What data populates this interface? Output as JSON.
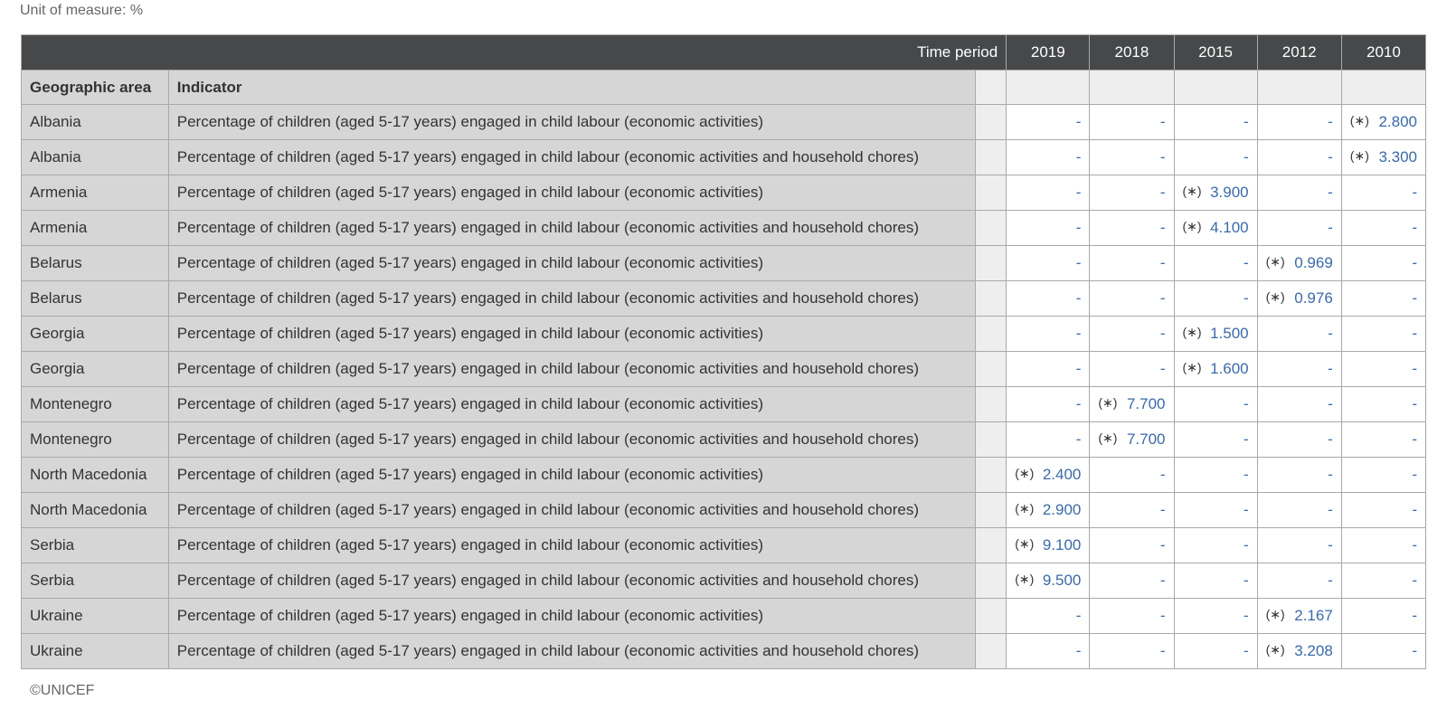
{
  "unit_label": "Unit of measure: %",
  "header": {
    "time_period": "Time period",
    "years": [
      "2019",
      "2018",
      "2015",
      "2012",
      "2010"
    ],
    "col_area": "Geographic area",
    "col_indicator": "Indicator"
  },
  "flag_symbol": "(∗)",
  "rows": [
    {
      "area": "Albania",
      "indicator": "Percentage of children (aged 5-17 years) engaged in child labour (economic activities)",
      "values": [
        "-",
        "-",
        "-",
        "-",
        "2.800"
      ],
      "flags": [
        false,
        false,
        false,
        false,
        true
      ],
      "blue": [
        false,
        false,
        false,
        false,
        true
      ]
    },
    {
      "area": "Albania",
      "indicator": "Percentage of children (aged 5-17 years) engaged in child labour (economic activities and household chores)",
      "values": [
        "-",
        "-",
        "-",
        "-",
        "3.300"
      ],
      "flags": [
        false,
        false,
        false,
        false,
        true
      ],
      "blue": [
        true,
        false,
        false,
        false,
        true
      ]
    },
    {
      "area": "Armenia",
      "indicator": "Percentage of children (aged 5-17 years) engaged in child labour (economic activities)",
      "values": [
        "-",
        "-",
        "3.900",
        "-",
        "-"
      ],
      "flags": [
        false,
        false,
        true,
        false,
        false
      ],
      "blue": [
        false,
        false,
        true,
        false,
        false
      ]
    },
    {
      "area": "Armenia",
      "indicator": "Percentage of children (aged 5-17 years) engaged in child labour (economic activities and household chores)",
      "values": [
        "-",
        "-",
        "4.100",
        "-",
        "-"
      ],
      "flags": [
        false,
        false,
        true,
        false,
        false
      ],
      "blue": [
        true,
        true,
        true,
        false,
        false
      ]
    },
    {
      "area": "Belarus",
      "indicator": "Percentage of children (aged 5-17 years) engaged in child labour (economic activities)",
      "values": [
        "-",
        "-",
        "-",
        "0.969",
        "-"
      ],
      "flags": [
        false,
        false,
        false,
        true,
        false
      ],
      "blue": [
        true,
        true,
        false,
        true,
        true
      ]
    },
    {
      "area": "Belarus",
      "indicator": "Percentage of children (aged 5-17 years) engaged in child labour (economic activities and household chores)",
      "values": [
        "-",
        "-",
        "-",
        "0.976",
        "-"
      ],
      "flags": [
        false,
        false,
        false,
        true,
        false
      ],
      "blue": [
        false,
        false,
        false,
        true,
        false
      ]
    },
    {
      "area": "Georgia",
      "indicator": "Percentage of children (aged 5-17 years) engaged in child labour (economic activities)",
      "values": [
        "-",
        "-",
        "1.500",
        "-",
        "-"
      ],
      "flags": [
        false,
        false,
        true,
        false,
        false
      ],
      "blue": [
        true,
        false,
        true,
        false,
        false
      ]
    },
    {
      "area": "Georgia",
      "indicator": "Percentage of children (aged 5-17 years) engaged in child labour (economic activities and household chores)",
      "values": [
        "-",
        "-",
        "1.600",
        "-",
        "-"
      ],
      "flags": [
        false,
        false,
        true,
        false,
        false
      ],
      "blue": [
        true,
        false,
        true,
        false,
        false
      ]
    },
    {
      "area": "Montenegro",
      "indicator": "Percentage of children (aged 5-17 years) engaged in child labour (economic activities)",
      "values": [
        "-",
        "7.700",
        "-",
        "-",
        "-"
      ],
      "flags": [
        false,
        true,
        false,
        false,
        false
      ],
      "blue": [
        true,
        true,
        false,
        false,
        false
      ]
    },
    {
      "area": "Montenegro",
      "indicator": "Percentage of children (aged 5-17 years) engaged in child labour (economic activities and household chores)",
      "values": [
        "-",
        "7.700",
        "-",
        "-",
        "-"
      ],
      "flags": [
        false,
        true,
        false,
        false,
        false
      ],
      "blue": [
        true,
        true,
        false,
        true,
        false
      ]
    },
    {
      "area": "North Macedonia",
      "indicator": "Percentage of children (aged 5-17 years) engaged in child labour (economic activities)",
      "values": [
        "2.400",
        "-",
        "-",
        "-",
        "-"
      ],
      "flags": [
        true,
        false,
        false,
        false,
        false
      ],
      "blue": [
        true,
        false,
        false,
        false,
        false
      ]
    },
    {
      "area": "North Macedonia",
      "indicator": "Percentage of children (aged 5-17 years) engaged in child labour (economic activities and household chores)",
      "values": [
        "2.900",
        "-",
        "-",
        "-",
        "-"
      ],
      "flags": [
        true,
        false,
        false,
        false,
        false
      ],
      "blue": [
        true,
        true,
        false,
        false,
        true
      ]
    },
    {
      "area": "Serbia",
      "indicator": "Percentage of children (aged 5-17 years) engaged in child labour (economic activities)",
      "values": [
        "9.100",
        "-",
        "-",
        "-",
        "-"
      ],
      "flags": [
        true,
        false,
        false,
        false,
        false
      ],
      "blue": [
        true,
        false,
        false,
        false,
        false
      ]
    },
    {
      "area": "Serbia",
      "indicator": "Percentage of children (aged 5-17 years) engaged in child labour (economic activities and household chores)",
      "values": [
        "9.500",
        "-",
        "-",
        "-",
        "-"
      ],
      "flags": [
        true,
        false,
        false,
        false,
        false
      ],
      "blue": [
        true,
        false,
        false,
        false,
        false
      ]
    },
    {
      "area": "Ukraine",
      "indicator": "Percentage of children (aged 5-17 years) engaged in child labour (economic activities)",
      "values": [
        "-",
        "-",
        "-",
        "2.167",
        "-"
      ],
      "flags": [
        false,
        false,
        false,
        true,
        false
      ],
      "blue": [
        true,
        true,
        false,
        true,
        false
      ]
    },
    {
      "area": "Ukraine",
      "indicator": "Percentage of children (aged 5-17 years) engaged in child labour (economic activities and household chores)",
      "values": [
        "-",
        "-",
        "-",
        "3.208",
        "-"
      ],
      "flags": [
        false,
        false,
        false,
        true,
        false
      ],
      "blue": [
        false,
        false,
        false,
        true,
        false
      ]
    }
  ],
  "footer": "©UNICEF",
  "colors": {
    "header_bg": "#46484a",
    "label_bg": "#d6d6d6",
    "value_link": "#3a6aa7"
  }
}
